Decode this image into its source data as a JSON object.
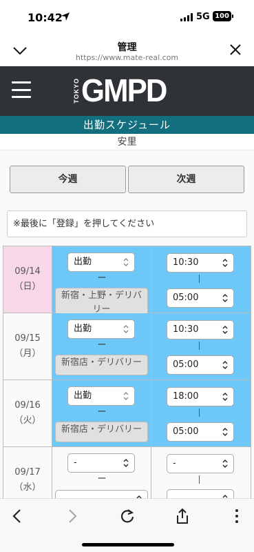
{
  "status": {
    "time": "10:42",
    "network": "5G",
    "battery": "100"
  },
  "browser": {
    "title": "管理",
    "url": "https://www.mate-real.com"
  },
  "site": {
    "logo_small": "TOKYO",
    "logo_main": "GMPD"
  },
  "page": {
    "title": "出勤スケジュール",
    "name": "安里"
  },
  "week": {
    "this_week": "今週",
    "next_week": "次週"
  },
  "notice": "※最後に「登録」を押してください",
  "schedule": [
    {
      "date": "09/14",
      "day": "（日）",
      "type": "出勤",
      "dash": "ー",
      "area": "新宿・上野・デリバリー",
      "start": "10:30",
      "end": "05:00"
    },
    {
      "date": "09/15",
      "day": "（月）",
      "type": "出勤",
      "dash": "ー",
      "area": "新宿店・デリバリー",
      "start": "10:30",
      "end": "05:00"
    },
    {
      "date": "09/16",
      "day": "（火）",
      "type": "出勤",
      "dash": "ー",
      "area": "新宿店・デリバリー",
      "start": "18:00",
      "end": "05:00"
    },
    {
      "date": "09/17",
      "day": "（水）",
      "type": "-",
      "dash": "ー",
      "area": "",
      "start": "-",
      "end": ""
    }
  ],
  "colors": {
    "header_bg": "#2f3338",
    "title_bg": "#136f7e",
    "active_cell": "#6ec8f7",
    "sunday": "#f7d7e8"
  }
}
